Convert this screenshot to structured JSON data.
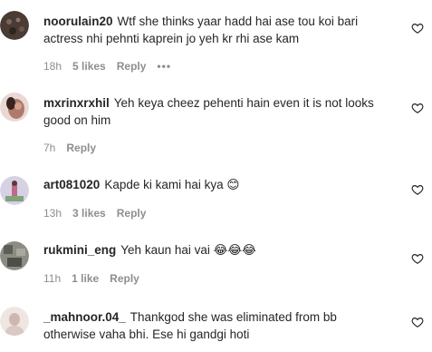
{
  "comments": [
    {
      "username": "noorulain20",
      "text": "Wtf she thinks yaar hadd hai ase tou koi bari actress nhi pehnti kaprein jo yeh kr rhi ase kam",
      "time": "18h",
      "likes": "5 likes",
      "reply_label": "Reply",
      "more_label": "•••",
      "avatar_color": "#4a3b34"
    },
    {
      "username": "mxrinxrxhil",
      "text": "Yeh keya cheez pehenti hain even it is not looks good on him",
      "time": "7h",
      "likes": "",
      "reply_label": "Reply",
      "avatar_color": "#b07a6a"
    },
    {
      "username": "art081020",
      "text": "Kapde ki kami hai kya 😊",
      "time": "13h",
      "likes": "3 likes",
      "reply_label": "Reply",
      "avatar_color": "#c9c3d8"
    },
    {
      "username": "rukmini_eng",
      "text": "Yeh kaun hai vai 😂😂😂",
      "time": "11h",
      "likes": "1 like",
      "reply_label": "Reply",
      "avatar_color": "#6a6a62"
    },
    {
      "username": "_mahnoor.04_",
      "text": "Thankgod she was eliminated from bb otherwise vaha bhi. Ese hi gandgi hoti",
      "time": "",
      "likes": "",
      "reply_label": "",
      "avatar_color": "#e8dcd8"
    }
  ],
  "icons": {
    "like": "heart-outline-icon",
    "more": "more-dots-icon"
  }
}
